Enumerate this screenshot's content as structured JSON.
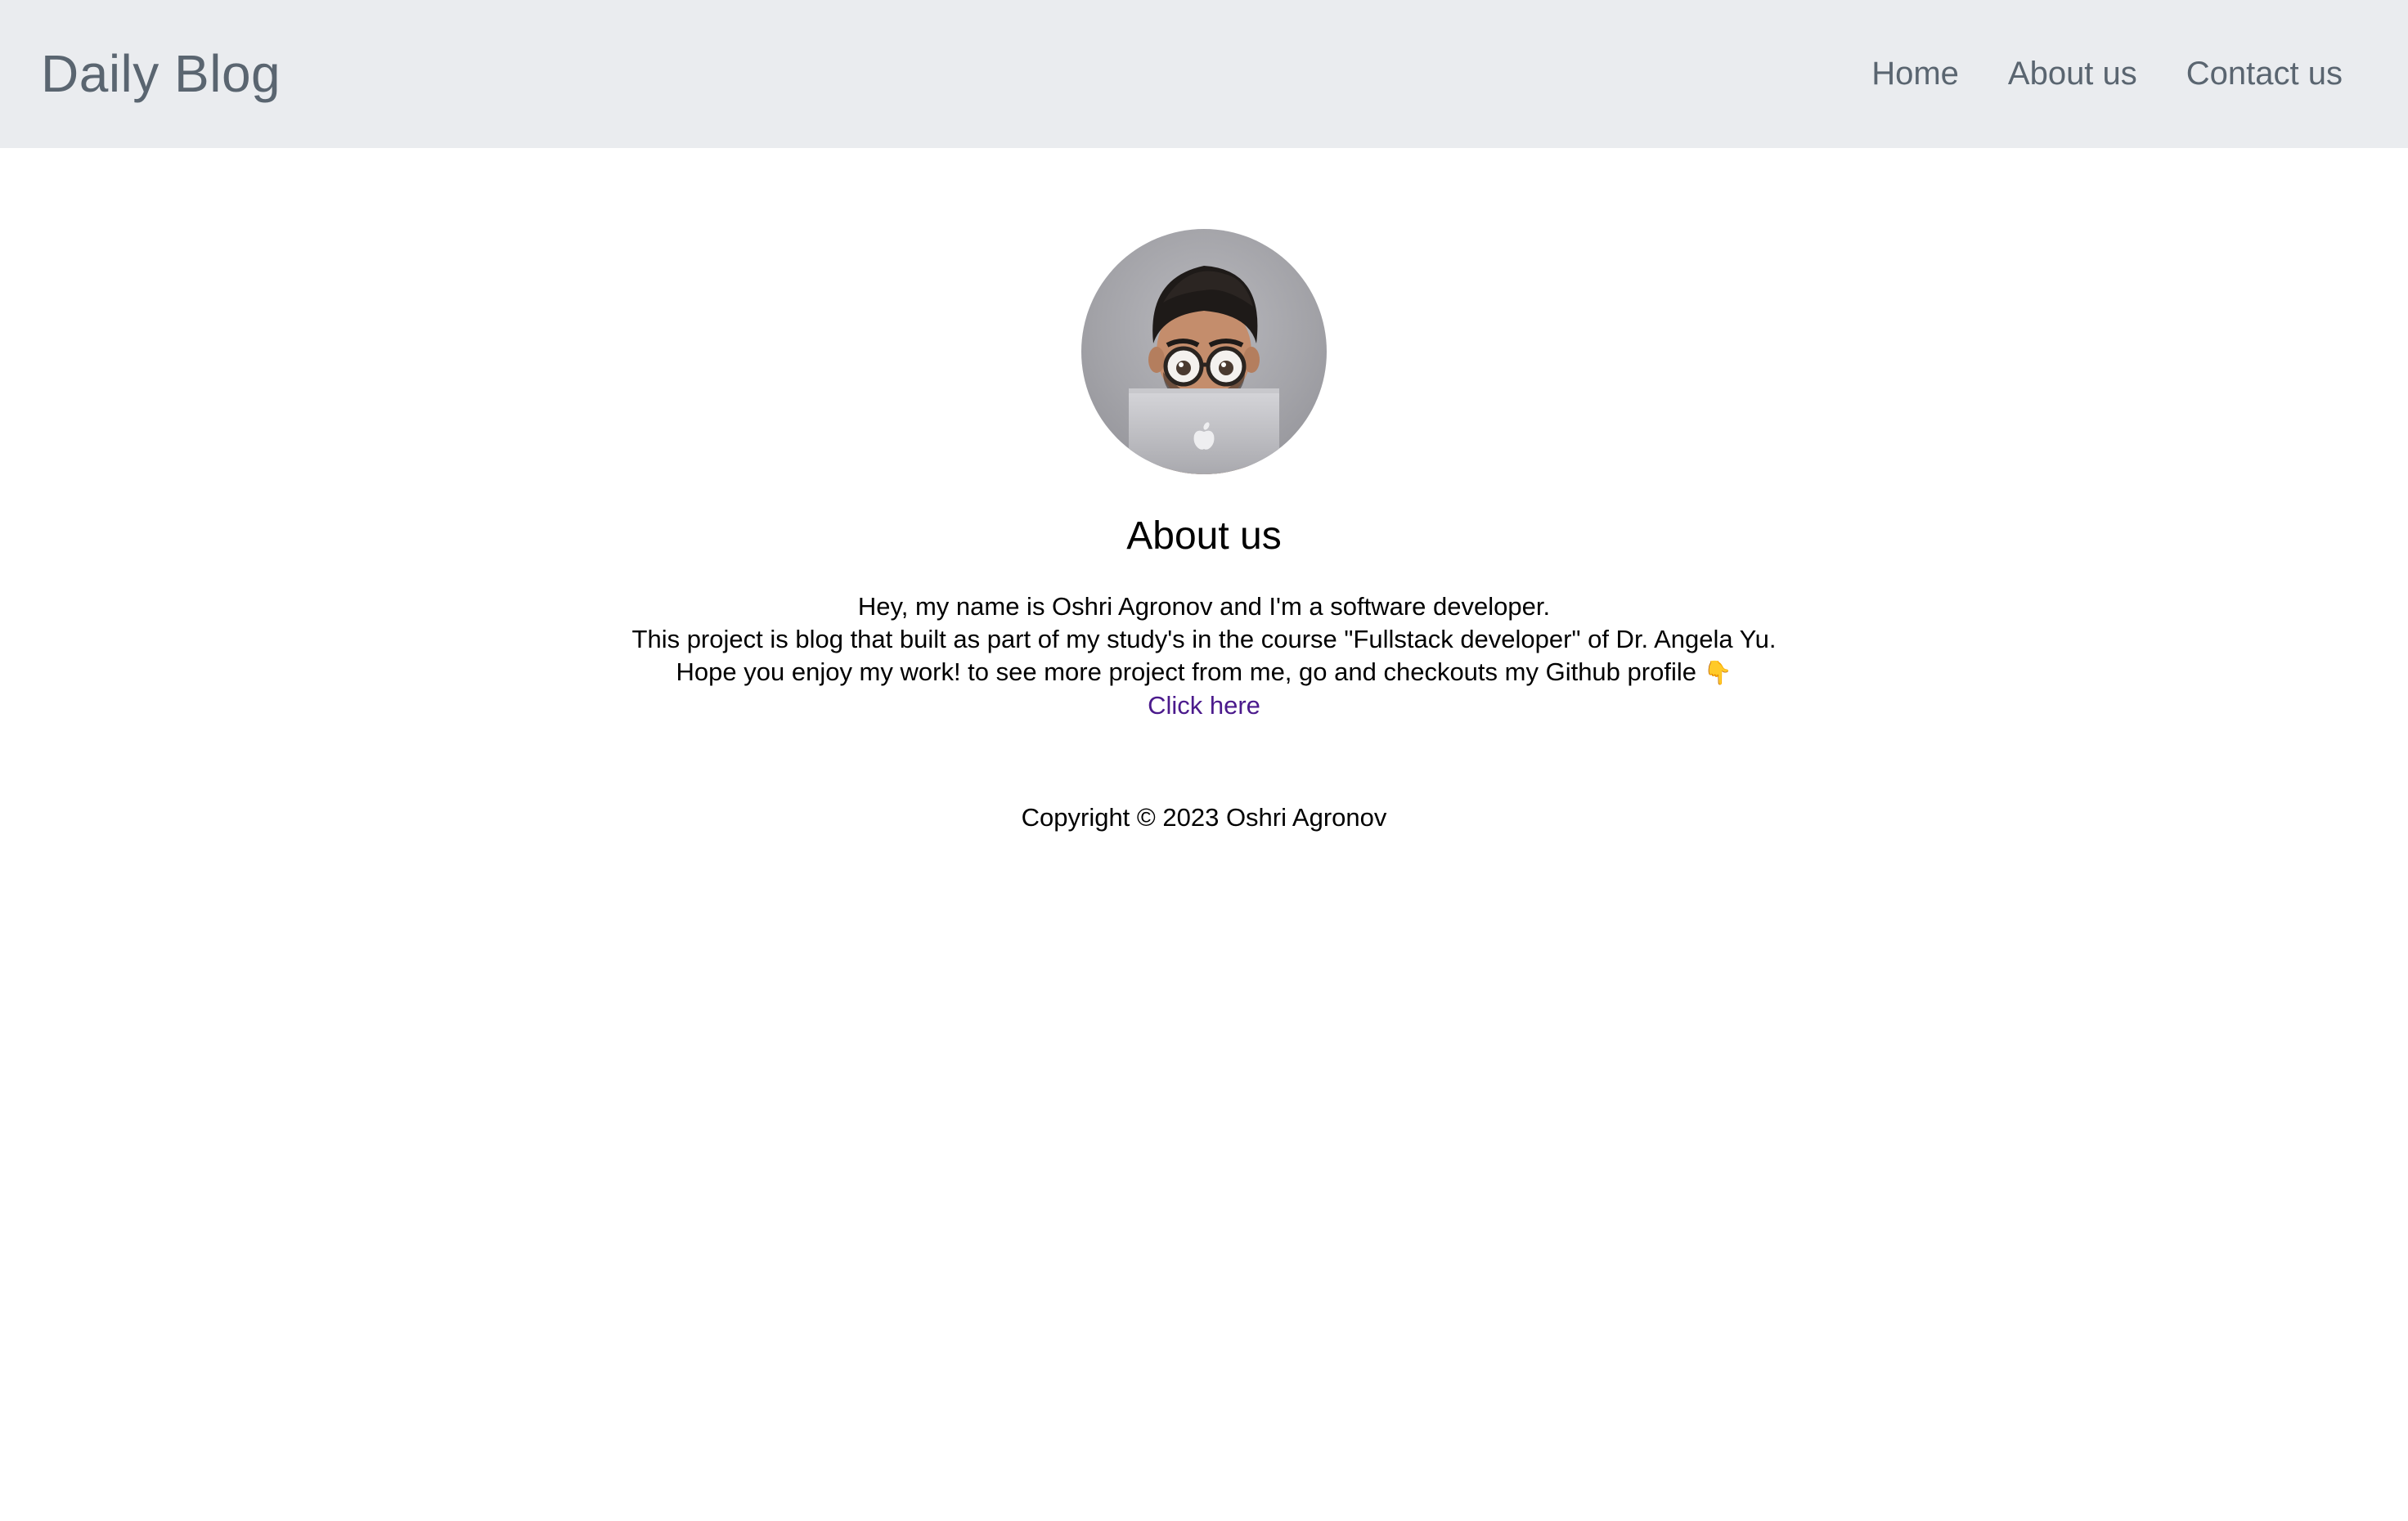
{
  "navbar": {
    "brand": "Daily Blog",
    "links": [
      {
        "label": "Home"
      },
      {
        "label": "About us"
      },
      {
        "label": "Contact us"
      }
    ]
  },
  "main": {
    "avatar_alt": "memoji avatar with laptop",
    "title": "About us",
    "bio_lines": [
      "Hey, my name is Oshri Agronov and I'm a software developer.",
      "This project is blog that built as part of my study's in the course \"Fullstack developer\" of Dr. Angela Yu.",
      "Hope you enjoy my work! to see more project from me, go and checkouts my Github profile"
    ],
    "emoji": "👇",
    "link_label": "Click here"
  },
  "footer": {
    "copyright": "Copyright © 2023 Oshri Agronov"
  },
  "colors": {
    "navbar_bg": "#eaecef",
    "nav_text": "#5a6570",
    "link": "#4b1a8c"
  }
}
